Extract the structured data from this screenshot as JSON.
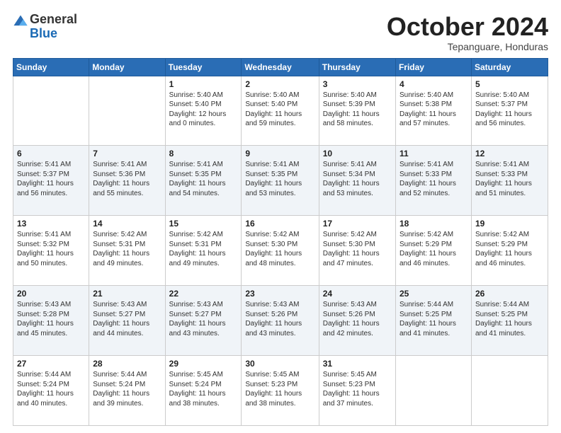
{
  "header": {
    "logo_general": "General",
    "logo_blue": "Blue",
    "month_title": "October 2024",
    "subtitle": "Tepanguare, Honduras"
  },
  "days_of_week": [
    "Sunday",
    "Monday",
    "Tuesday",
    "Wednesday",
    "Thursday",
    "Friday",
    "Saturday"
  ],
  "weeks": [
    [
      {
        "day": null
      },
      {
        "day": null
      },
      {
        "day": "1",
        "sunrise": "Sunrise: 5:40 AM",
        "sunset": "Sunset: 5:40 PM",
        "daylight": "Daylight: 12 hours and 0 minutes."
      },
      {
        "day": "2",
        "sunrise": "Sunrise: 5:40 AM",
        "sunset": "Sunset: 5:40 PM",
        "daylight": "Daylight: 11 hours and 59 minutes."
      },
      {
        "day": "3",
        "sunrise": "Sunrise: 5:40 AM",
        "sunset": "Sunset: 5:39 PM",
        "daylight": "Daylight: 11 hours and 58 minutes."
      },
      {
        "day": "4",
        "sunrise": "Sunrise: 5:40 AM",
        "sunset": "Sunset: 5:38 PM",
        "daylight": "Daylight: 11 hours and 57 minutes."
      },
      {
        "day": "5",
        "sunrise": "Sunrise: 5:40 AM",
        "sunset": "Sunset: 5:37 PM",
        "daylight": "Daylight: 11 hours and 56 minutes."
      }
    ],
    [
      {
        "day": "6",
        "sunrise": "Sunrise: 5:41 AM",
        "sunset": "Sunset: 5:37 PM",
        "daylight": "Daylight: 11 hours and 56 minutes."
      },
      {
        "day": "7",
        "sunrise": "Sunrise: 5:41 AM",
        "sunset": "Sunset: 5:36 PM",
        "daylight": "Daylight: 11 hours and 55 minutes."
      },
      {
        "day": "8",
        "sunrise": "Sunrise: 5:41 AM",
        "sunset": "Sunset: 5:35 PM",
        "daylight": "Daylight: 11 hours and 54 minutes."
      },
      {
        "day": "9",
        "sunrise": "Sunrise: 5:41 AM",
        "sunset": "Sunset: 5:35 PM",
        "daylight": "Daylight: 11 hours and 53 minutes."
      },
      {
        "day": "10",
        "sunrise": "Sunrise: 5:41 AM",
        "sunset": "Sunset: 5:34 PM",
        "daylight": "Daylight: 11 hours and 53 minutes."
      },
      {
        "day": "11",
        "sunrise": "Sunrise: 5:41 AM",
        "sunset": "Sunset: 5:33 PM",
        "daylight": "Daylight: 11 hours and 52 minutes."
      },
      {
        "day": "12",
        "sunrise": "Sunrise: 5:41 AM",
        "sunset": "Sunset: 5:33 PM",
        "daylight": "Daylight: 11 hours and 51 minutes."
      }
    ],
    [
      {
        "day": "13",
        "sunrise": "Sunrise: 5:41 AM",
        "sunset": "Sunset: 5:32 PM",
        "daylight": "Daylight: 11 hours and 50 minutes."
      },
      {
        "day": "14",
        "sunrise": "Sunrise: 5:42 AM",
        "sunset": "Sunset: 5:31 PM",
        "daylight": "Daylight: 11 hours and 49 minutes."
      },
      {
        "day": "15",
        "sunrise": "Sunrise: 5:42 AM",
        "sunset": "Sunset: 5:31 PM",
        "daylight": "Daylight: 11 hours and 49 minutes."
      },
      {
        "day": "16",
        "sunrise": "Sunrise: 5:42 AM",
        "sunset": "Sunset: 5:30 PM",
        "daylight": "Daylight: 11 hours and 48 minutes."
      },
      {
        "day": "17",
        "sunrise": "Sunrise: 5:42 AM",
        "sunset": "Sunset: 5:30 PM",
        "daylight": "Daylight: 11 hours and 47 minutes."
      },
      {
        "day": "18",
        "sunrise": "Sunrise: 5:42 AM",
        "sunset": "Sunset: 5:29 PM",
        "daylight": "Daylight: 11 hours and 46 minutes."
      },
      {
        "day": "19",
        "sunrise": "Sunrise: 5:42 AM",
        "sunset": "Sunset: 5:29 PM",
        "daylight": "Daylight: 11 hours and 46 minutes."
      }
    ],
    [
      {
        "day": "20",
        "sunrise": "Sunrise: 5:43 AM",
        "sunset": "Sunset: 5:28 PM",
        "daylight": "Daylight: 11 hours and 45 minutes."
      },
      {
        "day": "21",
        "sunrise": "Sunrise: 5:43 AM",
        "sunset": "Sunset: 5:27 PM",
        "daylight": "Daylight: 11 hours and 44 minutes."
      },
      {
        "day": "22",
        "sunrise": "Sunrise: 5:43 AM",
        "sunset": "Sunset: 5:27 PM",
        "daylight": "Daylight: 11 hours and 43 minutes."
      },
      {
        "day": "23",
        "sunrise": "Sunrise: 5:43 AM",
        "sunset": "Sunset: 5:26 PM",
        "daylight": "Daylight: 11 hours and 43 minutes."
      },
      {
        "day": "24",
        "sunrise": "Sunrise: 5:43 AM",
        "sunset": "Sunset: 5:26 PM",
        "daylight": "Daylight: 11 hours and 42 minutes."
      },
      {
        "day": "25",
        "sunrise": "Sunrise: 5:44 AM",
        "sunset": "Sunset: 5:25 PM",
        "daylight": "Daylight: 11 hours and 41 minutes."
      },
      {
        "day": "26",
        "sunrise": "Sunrise: 5:44 AM",
        "sunset": "Sunset: 5:25 PM",
        "daylight": "Daylight: 11 hours and 41 minutes."
      }
    ],
    [
      {
        "day": "27",
        "sunrise": "Sunrise: 5:44 AM",
        "sunset": "Sunset: 5:24 PM",
        "daylight": "Daylight: 11 hours and 40 minutes."
      },
      {
        "day": "28",
        "sunrise": "Sunrise: 5:44 AM",
        "sunset": "Sunset: 5:24 PM",
        "daylight": "Daylight: 11 hours and 39 minutes."
      },
      {
        "day": "29",
        "sunrise": "Sunrise: 5:45 AM",
        "sunset": "Sunset: 5:24 PM",
        "daylight": "Daylight: 11 hours and 38 minutes."
      },
      {
        "day": "30",
        "sunrise": "Sunrise: 5:45 AM",
        "sunset": "Sunset: 5:23 PM",
        "daylight": "Daylight: 11 hours and 38 minutes."
      },
      {
        "day": "31",
        "sunrise": "Sunrise: 5:45 AM",
        "sunset": "Sunset: 5:23 PM",
        "daylight": "Daylight: 11 hours and 37 minutes."
      },
      {
        "day": null
      },
      {
        "day": null
      }
    ]
  ]
}
